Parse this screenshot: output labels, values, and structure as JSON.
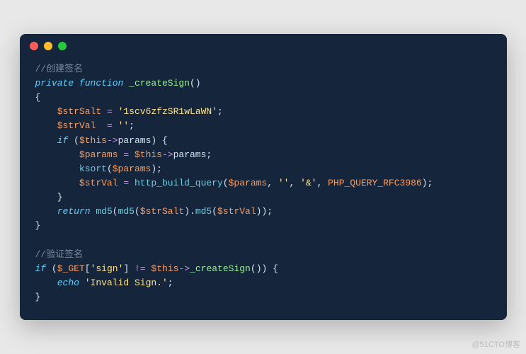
{
  "watermark": "@51CTO博客",
  "code": {
    "c1": "//创建签名",
    "kw_private": "private",
    "kw_function": "function",
    "fn_createSign": "_createSign",
    "paren_open": "(",
    "paren_close": ")",
    "brace_open": "{",
    "brace_close": "}",
    "var_strSalt": "$strSalt",
    "op_assign": "=",
    "str_salt": "'1scv6zfzSR1wLaWN'",
    "semi": ";",
    "var_strVal": "$strVal",
    "str_empty": "''",
    "kw_if": "if",
    "var_this": "$this",
    "op_arrow": "->",
    "prop_params": "params",
    "var_params": "$params",
    "fn_ksort": "ksort",
    "fn_httpbq": "http_build_query",
    "comma": ",",
    "str_amp": "'&'",
    "const_rfc": "PHP_QUERY_RFC3986",
    "kw_return": "return",
    "fn_md5": "md5",
    "dot": ".",
    "c2": "//验证签名",
    "var_get": "$_GET",
    "bracket_open": "[",
    "str_sign": "'sign'",
    "bracket_close": "]",
    "op_neq": "!=",
    "kw_echo": "echo",
    "str_invalid": "'Invalid Sign.'"
  }
}
